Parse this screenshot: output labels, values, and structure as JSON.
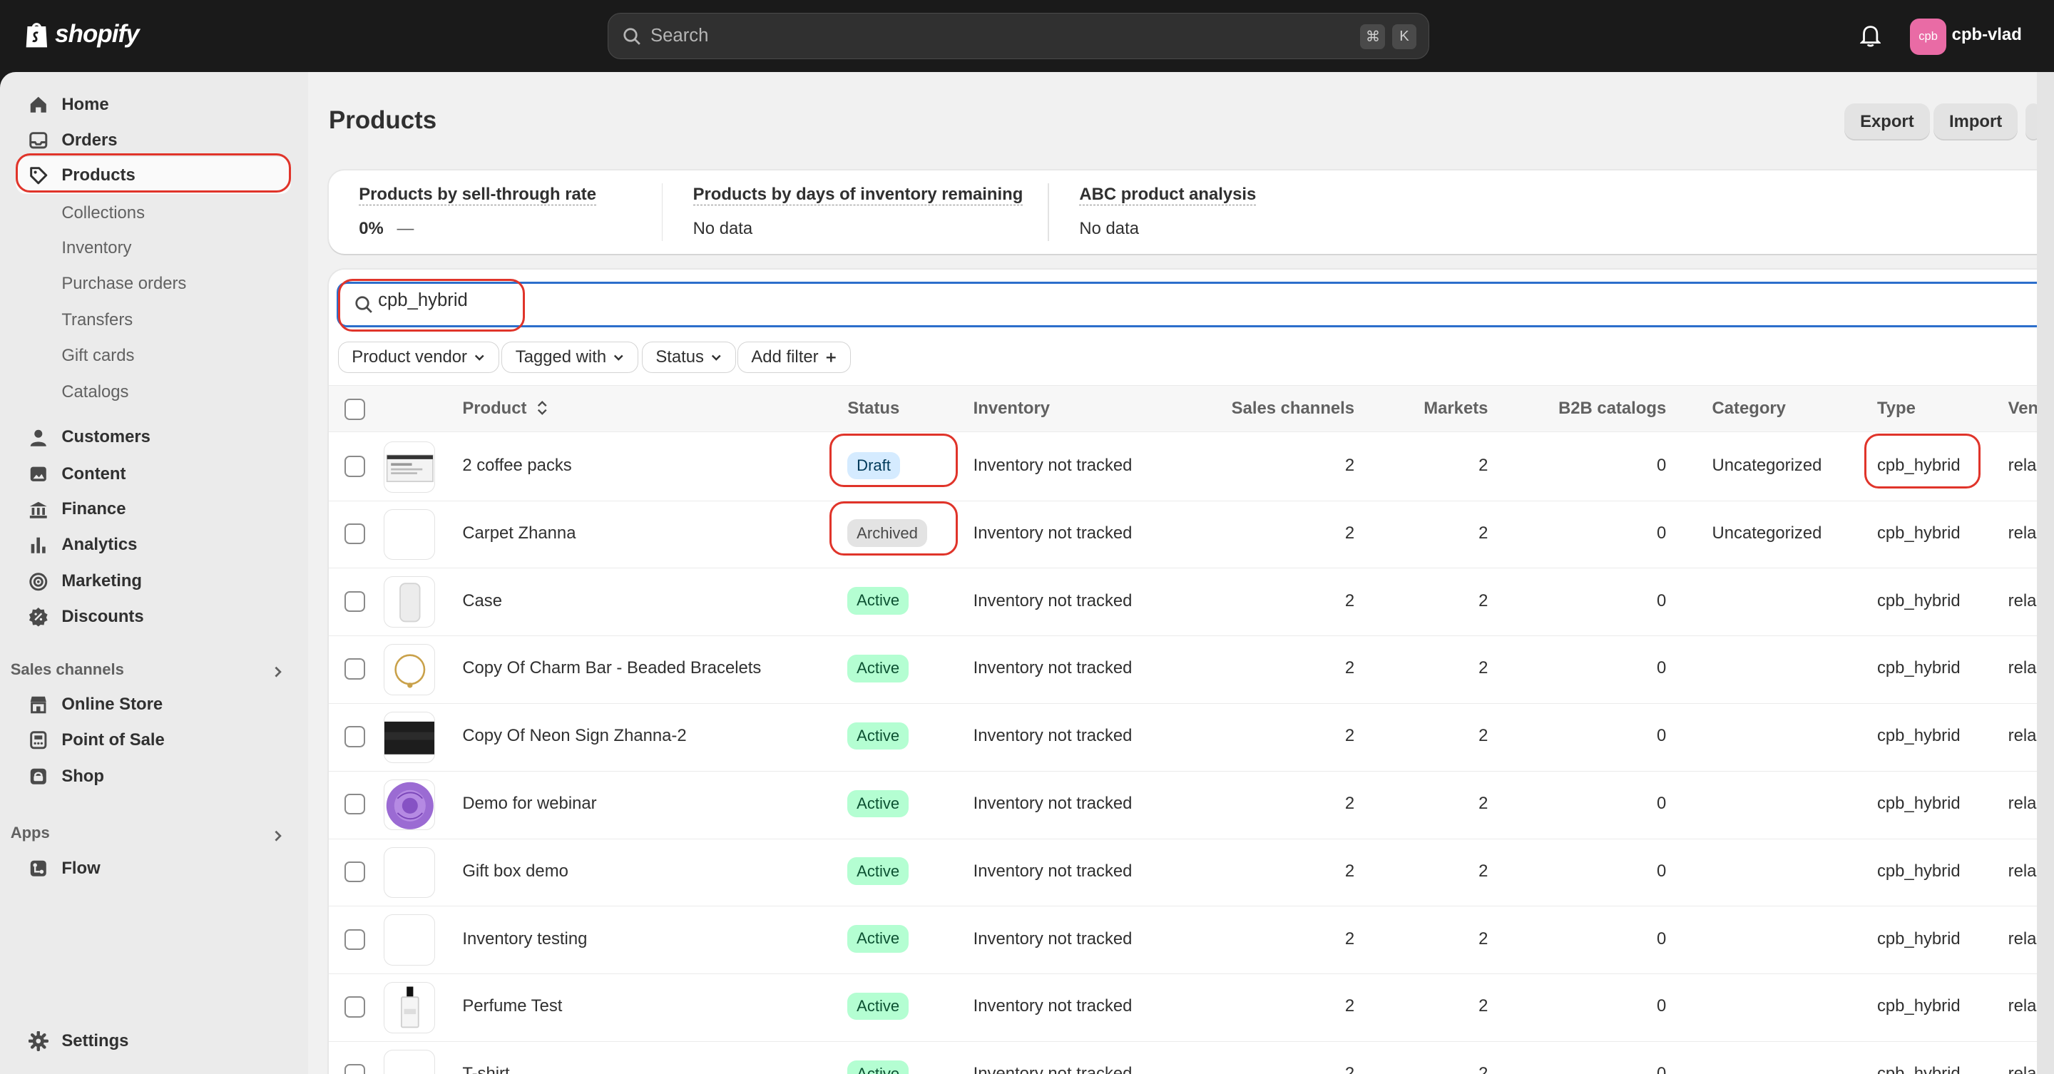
{
  "topbar": {
    "logo_text": "shopify",
    "search_placeholder": "Search",
    "shortcut_keys": [
      "⌘",
      "K"
    ],
    "store_initials": "cpb",
    "store_name": "cpb-vlad"
  },
  "sidebar": {
    "main_items": [
      {
        "label": "Home",
        "icon": "home-icon"
      },
      {
        "label": "Orders",
        "icon": "inbox-icon"
      },
      {
        "label": "Products",
        "icon": "tag-icon",
        "active": true
      }
    ],
    "product_sub_items": [
      "Collections",
      "Inventory",
      "Purchase orders",
      "Transfers",
      "Gift cards",
      "Catalogs"
    ],
    "more_items": [
      {
        "label": "Customers",
        "icon": "person-icon"
      },
      {
        "label": "Content",
        "icon": "content-icon"
      },
      {
        "label": "Finance",
        "icon": "bank-icon"
      },
      {
        "label": "Analytics",
        "icon": "bar-chart-icon"
      },
      {
        "label": "Marketing",
        "icon": "target-icon"
      },
      {
        "label": "Discounts",
        "icon": "discount-icon"
      }
    ],
    "sales_channels_title": "Sales channels",
    "sales_channels": [
      {
        "label": "Online Store",
        "icon": "store-icon"
      },
      {
        "label": "Point of Sale",
        "icon": "pos-icon"
      },
      {
        "label": "Shop",
        "icon": "shop-bag-icon"
      }
    ],
    "apps_title": "Apps",
    "apps": [
      {
        "label": "Flow",
        "icon": "flow-icon"
      }
    ],
    "settings_label": "Settings"
  },
  "page": {
    "title": "Products",
    "export_label": "Export",
    "import_label": "Import"
  },
  "metrics": [
    {
      "title": "Products by sell-through rate",
      "value": "0%",
      "trend": "—"
    },
    {
      "title": "Products by days of inventory remaining",
      "value": "No data"
    },
    {
      "title": "ABC product analysis",
      "value": "No data"
    }
  ],
  "filter": {
    "search_value": "cpb_hybrid",
    "chips": [
      "Product vendor",
      "Tagged with",
      "Status",
      "Add filter"
    ]
  },
  "table": {
    "columns": [
      "Product",
      "Status",
      "Inventory",
      "Sales channels",
      "Markets",
      "B2B catalogs",
      "Category",
      "Type",
      "Vendor"
    ],
    "rows": [
      {
        "product": "2 coffee packs",
        "status": "Draft",
        "status_kind": "draft",
        "inventory": "Inventory not tracked",
        "sales_channels": "2",
        "markets": "2",
        "b2b": "0",
        "category": "Uncategorized",
        "type": "cpb_hybrid",
        "vendor": "rela",
        "thumb": "screenshot"
      },
      {
        "product": "Carpet Zhanna",
        "status": "Archived",
        "status_kind": "archived",
        "inventory": "Inventory not tracked",
        "sales_channels": "2",
        "markets": "2",
        "b2b": "0",
        "category": "Uncategorized",
        "type": "cpb_hybrid",
        "vendor": "rela",
        "thumb": "blank"
      },
      {
        "product": "Case",
        "status": "Active",
        "status_kind": "active",
        "inventory": "Inventory not tracked",
        "sales_channels": "2",
        "markets": "2",
        "b2b": "0",
        "category": "",
        "type": "cpb_hybrid",
        "vendor": "rela",
        "thumb": "case"
      },
      {
        "product": "Copy Of Charm Bar - Beaded Bracelets",
        "status": "Active",
        "status_kind": "active",
        "inventory": "Inventory not tracked",
        "sales_channels": "2",
        "markets": "2",
        "b2b": "0",
        "category": "",
        "type": "cpb_hybrid",
        "vendor": "rela",
        "thumb": "bracelet"
      },
      {
        "product": "Copy Of Neon Sign Zhanna-2",
        "status": "Active",
        "status_kind": "active",
        "inventory": "Inventory not tracked",
        "sales_channels": "2",
        "markets": "2",
        "b2b": "0",
        "category": "",
        "type": "cpb_hybrid",
        "vendor": "rela",
        "thumb": "dark"
      },
      {
        "product": "Demo for webinar",
        "status": "Active",
        "status_kind": "active",
        "inventory": "Inventory not tracked",
        "sales_channels": "2",
        "markets": "2",
        "b2b": "0",
        "category": "",
        "type": "cpb_hybrid",
        "vendor": "rela",
        "thumb": "rose"
      },
      {
        "product": "Gift box demo",
        "status": "Active",
        "status_kind": "active",
        "inventory": "Inventory not tracked",
        "sales_channels": "2",
        "markets": "2",
        "b2b": "0",
        "category": "",
        "type": "cpb_hybrid",
        "vendor": "rela",
        "thumb": "blank"
      },
      {
        "product": "Inventory testing",
        "status": "Active",
        "status_kind": "active",
        "inventory": "Inventory not tracked",
        "sales_channels": "2",
        "markets": "2",
        "b2b": "0",
        "category": "",
        "type": "cpb_hybrid",
        "vendor": "rela",
        "thumb": "blank"
      },
      {
        "product": "Perfume Test",
        "status": "Active",
        "status_kind": "active",
        "inventory": "Inventory not tracked",
        "sales_channels": "2",
        "markets": "2",
        "b2b": "0",
        "category": "",
        "type": "cpb_hybrid",
        "vendor": "rela",
        "thumb": "perfume"
      },
      {
        "product": "T-shirt",
        "status": "Active",
        "status_kind": "active",
        "inventory": "Inventory not tracked",
        "sales_channels": "2",
        "markets": "2",
        "b2b": "0",
        "category": "",
        "type": "cpb_hybrid",
        "vendor": "rela",
        "thumb": "blank"
      }
    ]
  },
  "colors": {
    "highlight": "#e0342a",
    "topbar": "#1a1a1a",
    "focus": "#2c6ecb"
  }
}
